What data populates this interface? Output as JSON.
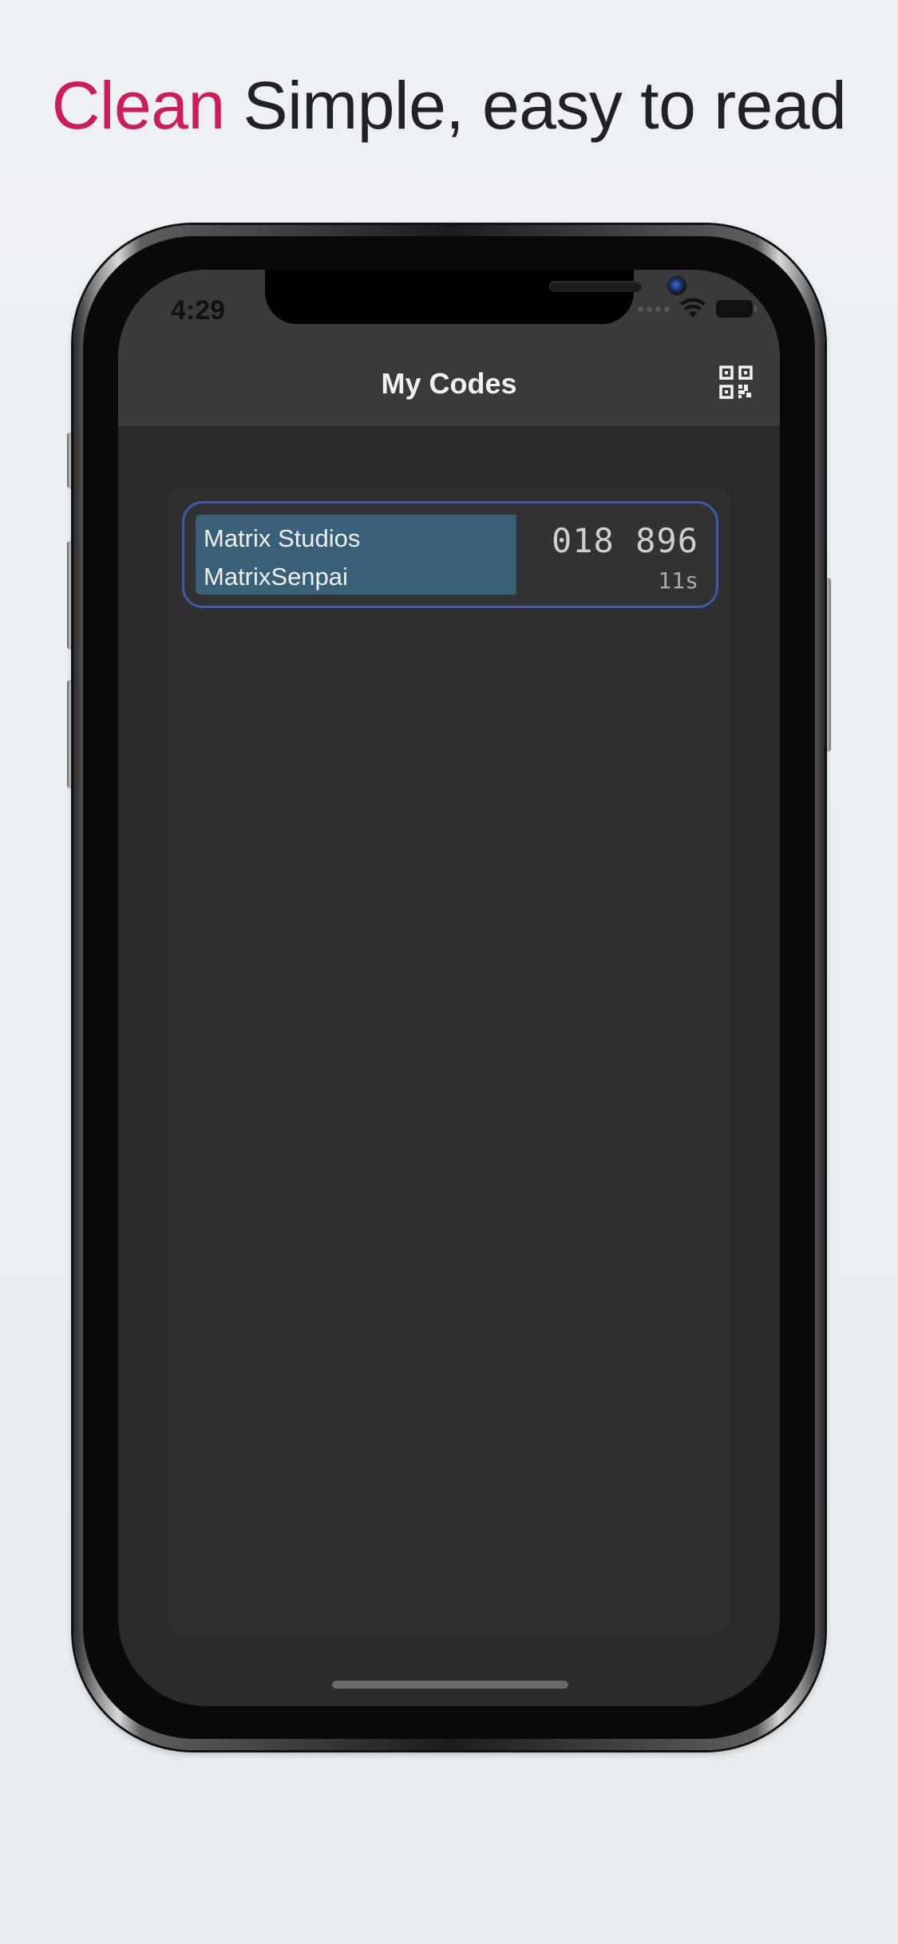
{
  "headline": {
    "accent": "Clean",
    "rest": " Simple, easy to read"
  },
  "colors": {
    "accent": "#cc1d5a",
    "card_border": "#3e5aa8",
    "progress_fill": "#3a6079",
    "screen_bg": "#2a2a2a",
    "navbar_bg": "#3a3a3a"
  },
  "status_bar": {
    "time": "4:29",
    "icons": [
      "signal-dots-icon",
      "wifi-icon",
      "battery-icon"
    ]
  },
  "nav": {
    "title": "My Codes",
    "action_icon": "qr-code-icon"
  },
  "codes": [
    {
      "issuer": "Matrix Studios",
      "account": "MatrixSenpai",
      "code": "018 896",
      "remaining": "11s",
      "progress": 0.63
    }
  ]
}
